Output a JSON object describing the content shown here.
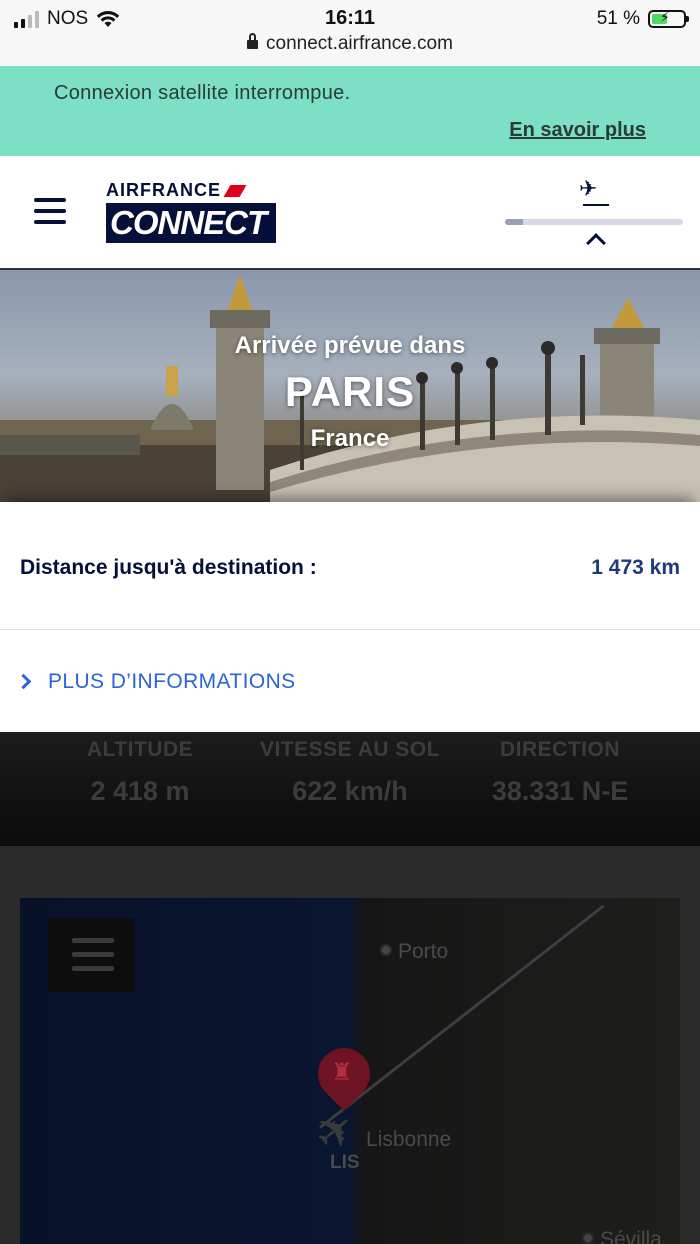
{
  "status_bar": {
    "carrier": "NOS",
    "time": "16:11",
    "battery": "51 %",
    "battery_level_pct": 51,
    "url": "connect.airfrance.com",
    "icons": [
      "signal-icon",
      "wifi-icon",
      "lock-icon",
      "battery-icon"
    ]
  },
  "banner": {
    "message": "Connexion satellite interrompue.",
    "link": "En savoir plus",
    "color": "#7ddfc3"
  },
  "header": {
    "logo_top": "AIRFRANCE",
    "logo_bottom": "CONNECT",
    "brand_color": "#051039",
    "accent_color": "#e1001a",
    "flight_progress_pct": 10
  },
  "hero": {
    "subtitle": "Arrivée prévue dans",
    "city": "PARIS",
    "country": "France"
  },
  "distance": {
    "label": "Distance jusqu'à destination :",
    "value": "1 473 km"
  },
  "more_info": {
    "label": "PLUS D’INFORMATIONS",
    "color": "#2b63d9"
  },
  "stats": {
    "altitude": {
      "label": "ALTITUDE",
      "value": "2 418 m"
    },
    "ground_speed": {
      "label": "VITESSE AU SOL",
      "value": "622 km/h"
    },
    "direction": {
      "label": "DIRECTION",
      "value": "38.331 N-E"
    }
  },
  "map": {
    "cities": {
      "porto": "Porto",
      "lisbonne": "Lisbonne",
      "sevilla": "Sévilla"
    },
    "origin_code": "LIS"
  }
}
